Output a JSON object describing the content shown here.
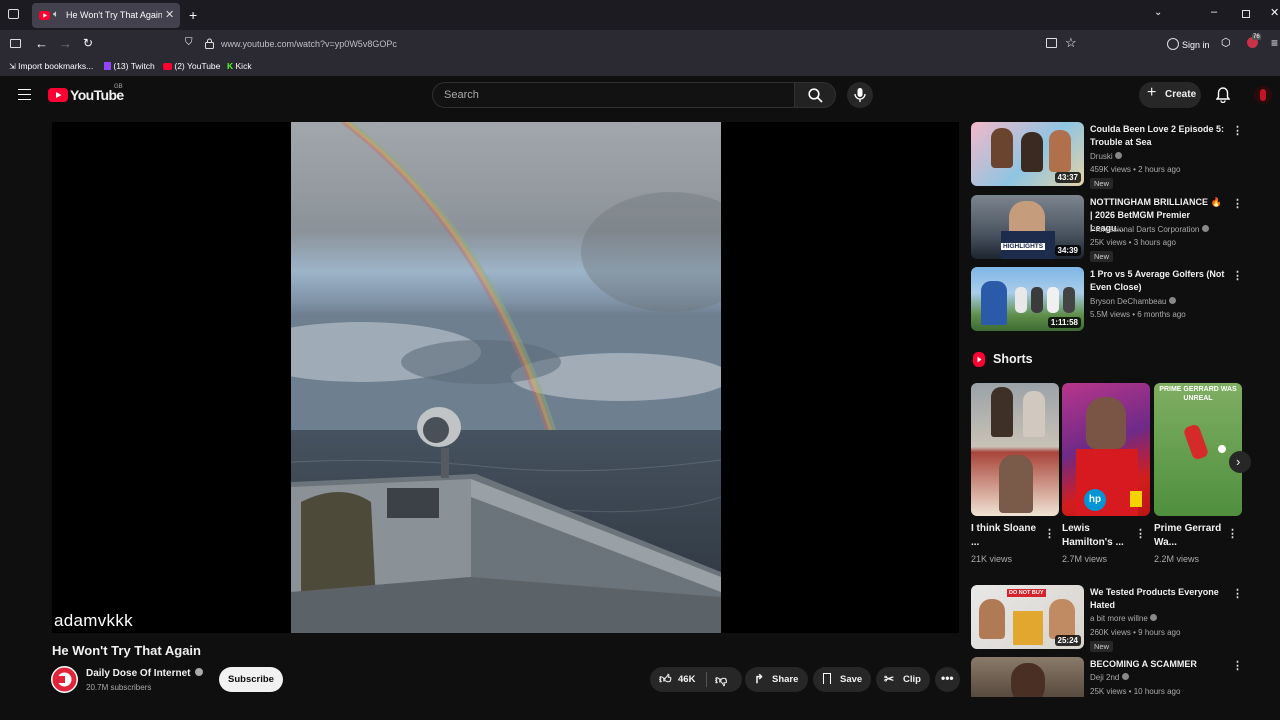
{
  "browser": {
    "tab_title": "He Won't Try That Again - YouTube",
    "tab_title_visible": "He Won't Try That Again - Y",
    "url": "www.youtube.com/watch?v=yp0W5v8GOPc",
    "sign_in": "Sign in",
    "bookmarks": [
      {
        "label": "Import bookmarks..."
      },
      {
        "label": "(13) Twitch"
      },
      {
        "label": "(2) YouTube"
      },
      {
        "label": "Kick"
      }
    ],
    "ext_badge": "76"
  },
  "header": {
    "logo_text": "YouTube",
    "country": "GB",
    "search_placeholder": "Search",
    "create_label": "Create"
  },
  "video": {
    "title": "He Won't Try That Again",
    "watermark": "adamvkkk",
    "channel": "Daily Dose Of Internet",
    "subscribers": "20.7M subscribers",
    "subscribe_label": "Subscribe",
    "likes": "46K",
    "share_label": "Share",
    "save_label": "Save",
    "clip_label": "Clip"
  },
  "sidebar": {
    "recs_top": [
      {
        "title": "Coulda Been Love 2 Episode 5: Trouble at Sea",
        "channel": "Druski",
        "meta": "459K views • 2 hours ago",
        "badge": "New",
        "duration": "43:37"
      },
      {
        "title": "NOTTINGHAM BRILLIANCE 🔥 | 2026 BetMGM Premier Leagu...",
        "channel": "Professional Darts Corporation",
        "meta": "25K views • 3 hours ago",
        "badge": "New",
        "duration": "34:39"
      },
      {
        "title": "1 Pro vs 5 Average Golfers (Not Even Close)",
        "channel": "Bryson DeChambeau",
        "meta": "5.5M views • 6 months ago",
        "badge": "",
        "duration": "1:11:58"
      }
    ],
    "shorts_heading": "Shorts",
    "shorts": [
      {
        "title": "I think Sloane ...",
        "views": "21K views"
      },
      {
        "title": "Lewis Hamilton's ...",
        "views": "2.7M views"
      },
      {
        "title": "Prime Gerrard Wa...",
        "views": "2.2M views",
        "overlay": "PRIME GERRARD WAS UNREAL"
      }
    ],
    "recs_bottom": [
      {
        "title": "We Tested Products Everyone Hated",
        "channel": "a bit more willne",
        "meta": "260K views • 9 hours ago",
        "badge": "New",
        "duration": "25:24",
        "thumb_text": "DO NOT BUY"
      },
      {
        "title": "BECOMING A SCAMMER",
        "channel": "Deji 2nd",
        "meta": "25K views • 10 hours ago",
        "badge": "",
        "duration": ""
      }
    ]
  },
  "colors": {
    "youtube_red": "#ff0033",
    "bg": "#0f0f0f",
    "chip": "#272727"
  }
}
